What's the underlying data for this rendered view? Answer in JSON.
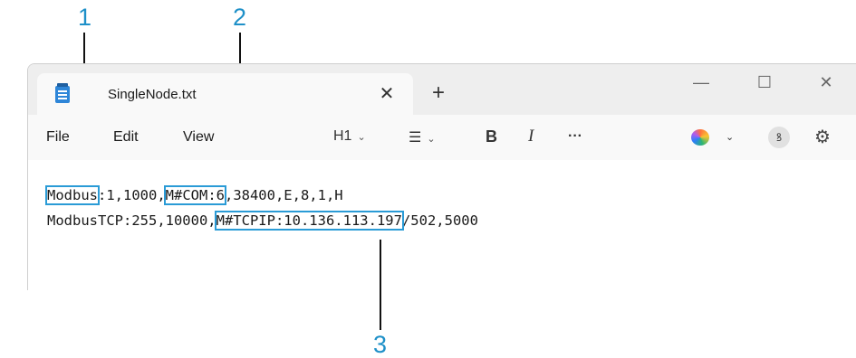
{
  "callouts": [
    "1",
    "2",
    "3"
  ],
  "window": {
    "tab_title": "SingleNode.txt",
    "tab_close": "✕",
    "new_tab": "+",
    "minimize": "—",
    "maximize": "☐",
    "close": "✕"
  },
  "menu": {
    "file": "File",
    "edit": "Edit",
    "view": "View"
  },
  "toolbar": {
    "heading": "H1",
    "list_icon": "☰",
    "bold": "B",
    "italic": "I",
    "more": "···",
    "chevron": "⌄",
    "avatar_glyph": "ꝸ",
    "gear_glyph": "⚙"
  },
  "editor": {
    "line1": {
      "seg1": "Modbus",
      "seg2": ":1,1000,",
      "seg3": "M#COM:6",
      "seg4": ",38400,E,8,1,H"
    },
    "line2": {
      "seg1": "ModbusTCP:255,10000,",
      "seg2": "M#TCPIP:10.136.113.197",
      "seg3": "/502,5000"
    }
  },
  "colors": {
    "callout": "#1e90c8",
    "highlight_box": "#2a9bd6"
  }
}
